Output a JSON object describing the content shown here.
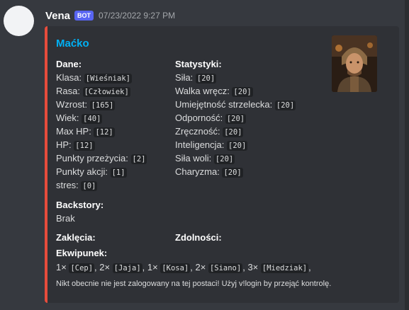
{
  "message": {
    "username": "Vena",
    "bot_tag": "BOT",
    "timestamp": "07/23/2022 9:27 PM"
  },
  "embed": {
    "accent_color": "#e74c3c",
    "title": "Maćko",
    "dane": {
      "name": "Dane:",
      "lines": [
        {
          "label": "Klasa:",
          "value": "[Wieśniak]"
        },
        {
          "label": "Rasa:",
          "value": "[Człowiek]"
        },
        {
          "label": "Wzrost:",
          "value": "[165]"
        },
        {
          "label": "Wiek:",
          "value": "[40]"
        },
        {
          "label": "Max HP:",
          "value": "[12]"
        },
        {
          "label": "HP:",
          "value": "[12]"
        },
        {
          "label": "Punkty przeżycia:",
          "value": "[2]"
        },
        {
          "label": "Punkty akcji:",
          "value": "[1]"
        },
        {
          "label": "stres:",
          "value": "[0]"
        }
      ]
    },
    "statystyki": {
      "name": "Statystyki:",
      "lines": [
        {
          "label": "Siła:",
          "value": "[20]"
        },
        {
          "label": "Walka wręcz:",
          "value": "[20]"
        },
        {
          "label": "Umiejętność strzelecka:",
          "value": "[20]"
        },
        {
          "label": "Odporność:",
          "value": "[20]"
        },
        {
          "label": "Zręczność:",
          "value": "[20]"
        },
        {
          "label": "Inteligencja:",
          "value": "[20]"
        },
        {
          "label": "Siła woli:",
          "value": "[20]"
        },
        {
          "label": "Charyzma:",
          "value": "[20]"
        }
      ]
    },
    "backstory": {
      "name": "Backstory:",
      "value": "Brak"
    },
    "zaklecia": {
      "name": "Zaklęcia:"
    },
    "zdolnosci": {
      "name": "Zdolności:"
    },
    "ekwipunek": {
      "name": "Ekwipunek:",
      "items": [
        {
          "count": "1×",
          "item": "[Cep]"
        },
        {
          "count": "2×",
          "item": "[Jaja]"
        },
        {
          "count": "1×",
          "item": "[Kosa]"
        },
        {
          "count": "2×",
          "item": "[Siano]"
        },
        {
          "count": "3×",
          "item": "[Miedziak]"
        }
      ]
    },
    "footer": "Nikt obecnie nie jest zalogowany na tej postaci! Użyj v!login by przejąć kontrolę."
  },
  "icons": {
    "thumbnail": "character-portrait"
  }
}
